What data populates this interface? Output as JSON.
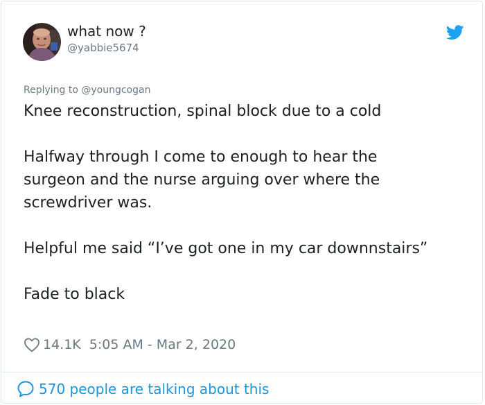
{
  "author": {
    "display_name": "what now ?",
    "handle": "@yabbie5674",
    "avatar_icon": "user-photo"
  },
  "reply_context": "Replying to @youngcogan",
  "tweet": {
    "paragraphs": [
      "Knee reconstruction, spinal block due to a cold",
      "Halfway through I come to enough to hear the surgeon and the nurse arguing over where the screwdriver was.",
      "Helpful me said “I’ve got one in my car downnstairs”",
      "Fade to black"
    ]
  },
  "meta": {
    "likes": "14.1K",
    "timestamp": "5:05 AM - Mar 2, 2020"
  },
  "footer": {
    "talking_label": "570 people are talking about this"
  },
  "colors": {
    "brand": "#1da1f2",
    "link": "#1b95e0",
    "muted": "#697882",
    "text": "#1c2022"
  },
  "icons": {
    "brand": "twitter-bird-icon",
    "like": "heart-icon",
    "reply": "speech-bubble-icon"
  }
}
